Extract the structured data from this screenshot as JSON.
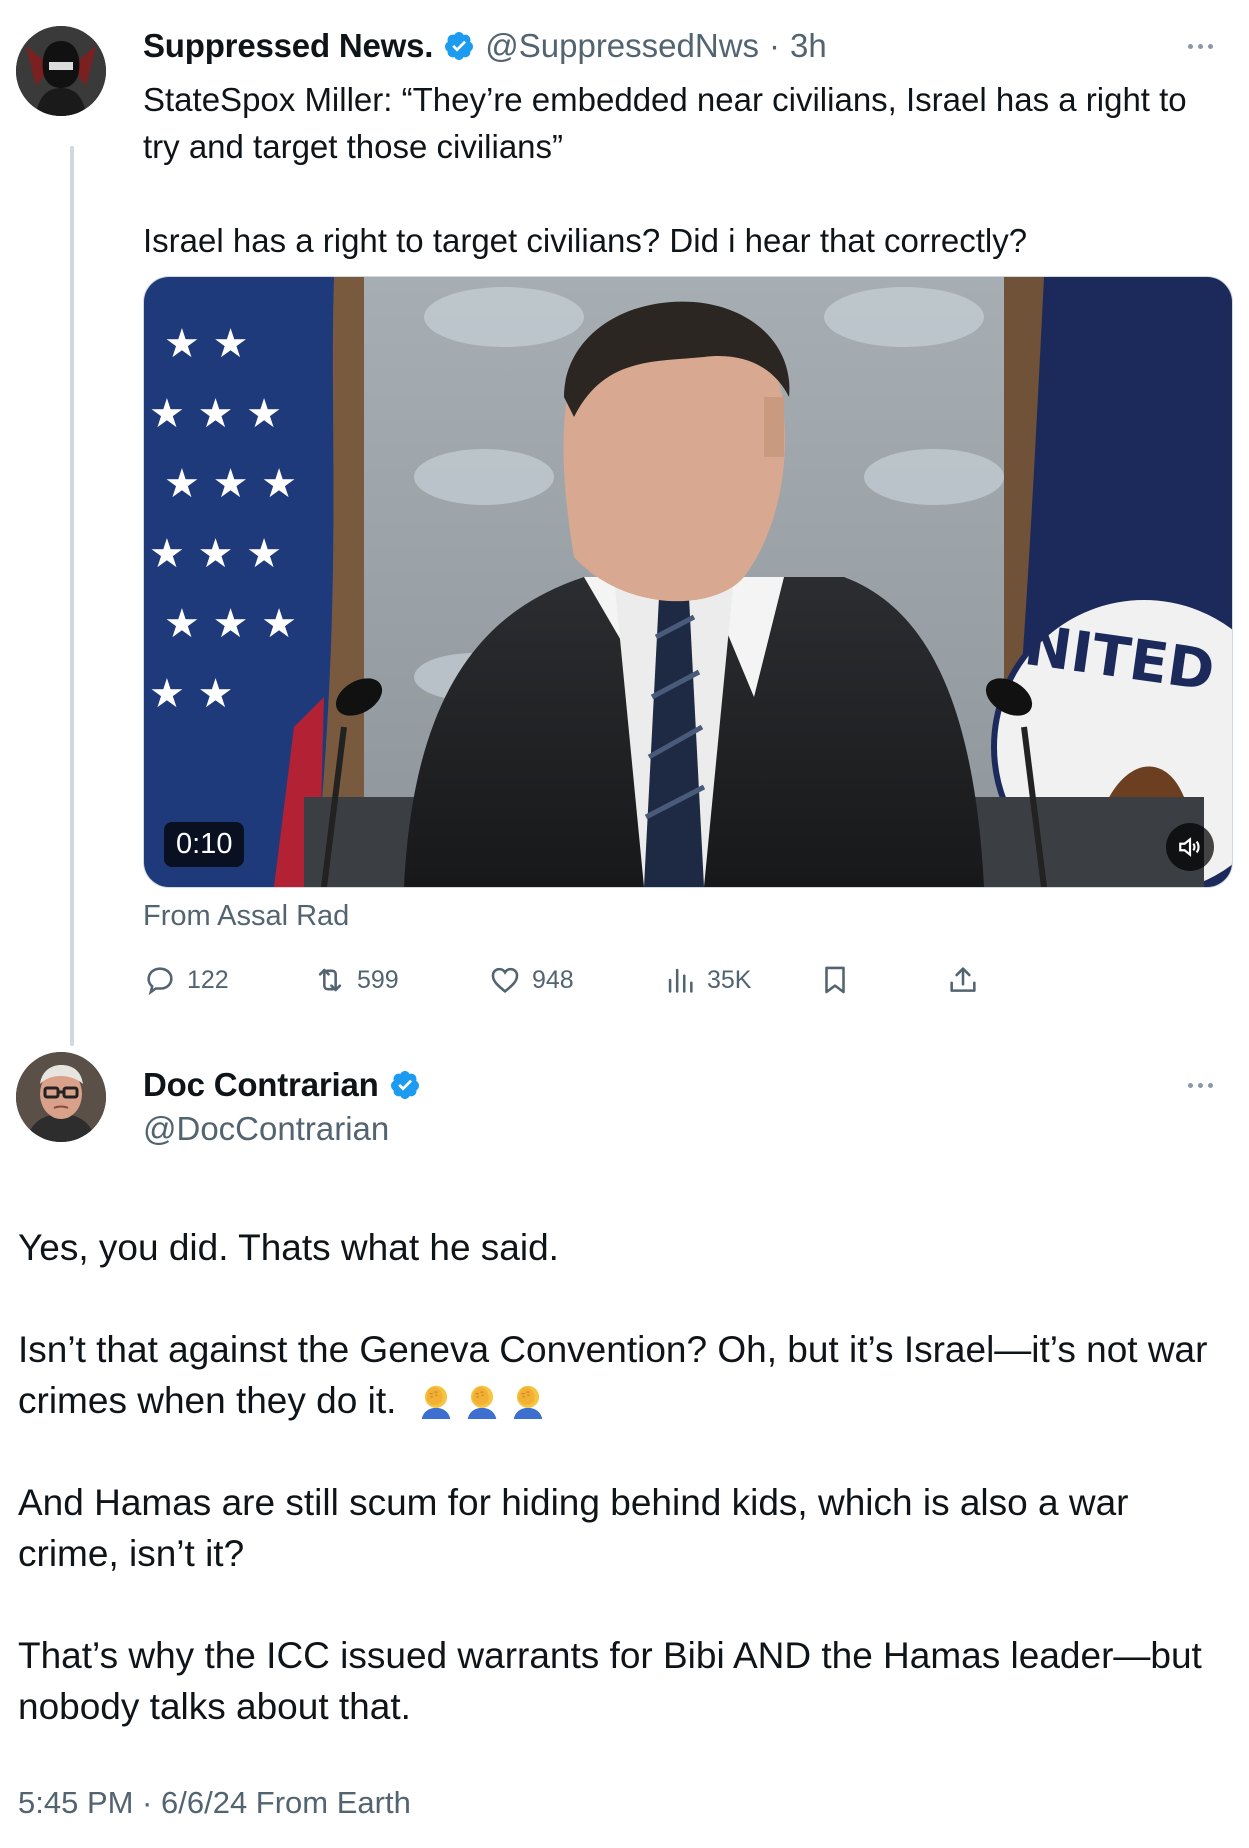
{
  "tweet1": {
    "display_name": "Suppressed News.",
    "handle": "@SuppressedNws",
    "separator": "·",
    "time_ago": "3h",
    "text_line1": "StateSpox Miller: “They’re embedded near civilians, Israel has a right to try and target those civilians”",
    "text_line2": "Israel has a right to target civilians? Did i hear that correctly?",
    "video": {
      "duration": "0:10",
      "seal_text": "NITED STAT"
    },
    "from_label": "From Assal Rad",
    "actions": {
      "replies": "122",
      "reposts": "599",
      "likes": "948",
      "views": "35K"
    }
  },
  "tweet2": {
    "display_name": "Doc Contrarian",
    "handle": "@DocContrarian",
    "paragraph1": "Yes, you did. Thats what he said.",
    "paragraph2": "Isn’t that against the Geneva Convention? Oh, but it’s Israel—it’s not war crimes when they do it.",
    "paragraph3": "And Hamas are still scum for hiding behind kids, which is also a war crime, isn’t it?",
    "paragraph4": "That’s why the ICC issued warrants for Bibi AND the Hamas leader—but nobody talks about that.",
    "timestamp": "5:45 PM · 6/6/24 From Earth"
  },
  "colors": {
    "verified_blue": "#1d9bf0",
    "muted_gray": "#536471",
    "thread_line": "#cfd9de"
  },
  "icons": [
    "verified-badge-icon",
    "more-options-icon",
    "reply-icon",
    "repost-icon",
    "like-icon",
    "views-icon",
    "bookmark-icon",
    "share-icon",
    "mute-icon",
    "facepalm-emoji-icon"
  ]
}
